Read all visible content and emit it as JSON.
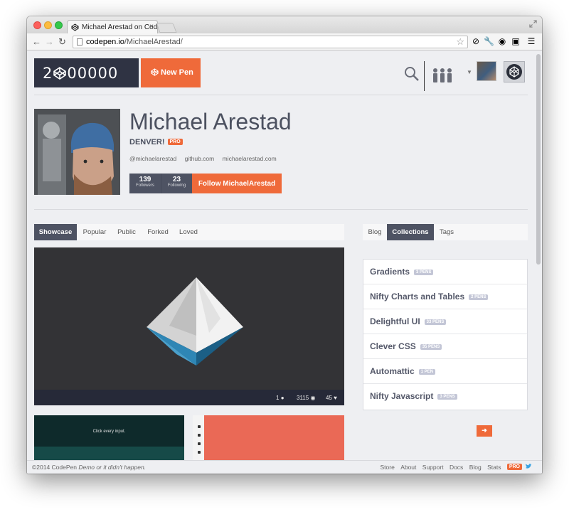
{
  "browser": {
    "tab_title": "Michael Arestad on CodeP",
    "tab_close": "×",
    "url_host": "codepen.io",
    "url_path": "/MichaelArestad/"
  },
  "header": {
    "logo_text_left": "2",
    "logo_text_right": "00000",
    "new_pen_label": "New Pen"
  },
  "profile": {
    "name": "Michael Arestad",
    "location": "DENVER!",
    "pro_badge": "PRO",
    "links": [
      "@michaelarestad",
      "github.com",
      "michaelarestad.com"
    ],
    "followers_count": "139",
    "followers_label": "Followers",
    "following_count": "23",
    "following_label": "Following",
    "follow_button": "Follow MichaelArestad"
  },
  "pen_tabs": [
    {
      "label": "Showcase",
      "active": true
    },
    {
      "label": "Popular",
      "active": false
    },
    {
      "label": "Public",
      "active": false
    },
    {
      "label": "Forked",
      "active": false
    },
    {
      "label": "Loved",
      "active": false
    }
  ],
  "side_tabs": [
    {
      "label": "Blog",
      "active": false
    },
    {
      "label": "Collections",
      "active": true
    },
    {
      "label": "Tags",
      "active": false
    }
  ],
  "showcase": {
    "comments": "1",
    "views": "3115",
    "hearts": "45"
  },
  "collections": [
    {
      "name": "Gradients",
      "count": "3 PENS"
    },
    {
      "name": "Nifty Charts and Tables",
      "count": "2 PENS"
    },
    {
      "name": "Delightful UI",
      "count": "33 PENS"
    },
    {
      "name": "Clever CSS",
      "count": "35 PENS"
    },
    {
      "name": "Automattic",
      "count": "1 PEN"
    },
    {
      "name": "Nifty Javascript",
      "count": "3 PENS"
    }
  ],
  "more_arrow": "➜",
  "thumb_text": "Click every input.",
  "footer": {
    "copyright": "©2014 CodePen",
    "tagline": "Demo or it didn't happen.",
    "links": [
      "Store",
      "About",
      "Support",
      "Docs",
      "Blog",
      "Stats"
    ],
    "pro": "PRO"
  },
  "colors": {
    "accent": "#ef6a3a",
    "dark": "#2f3343",
    "tab_active": "#4e5363"
  }
}
